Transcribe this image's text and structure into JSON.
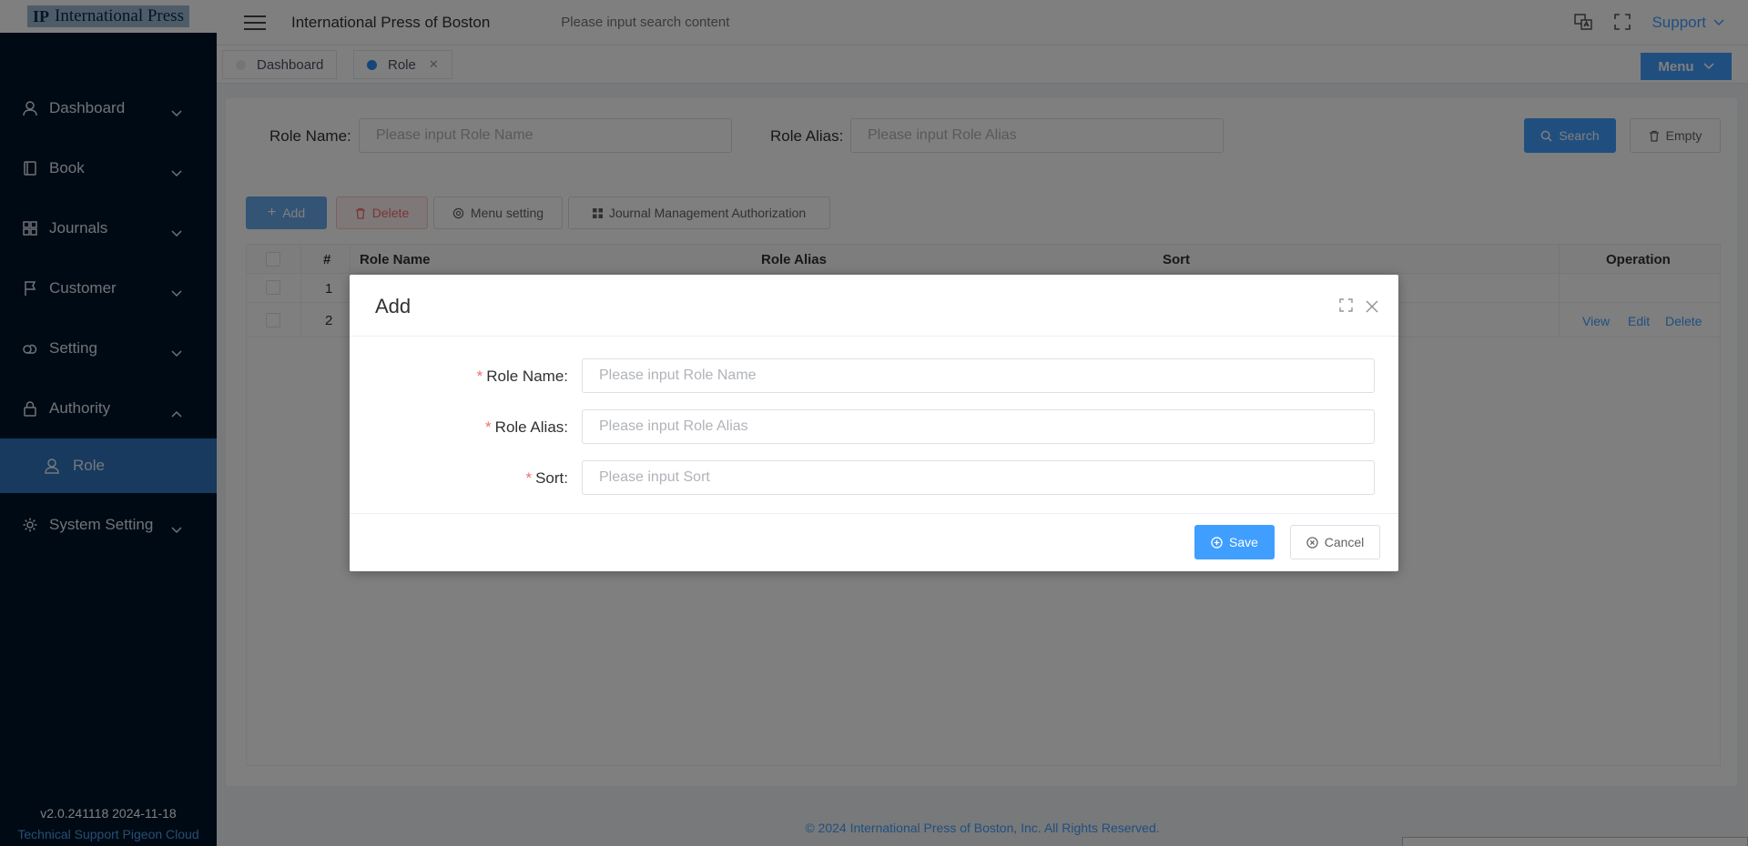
{
  "logo": {
    "mark": "IP",
    "text": "International Press"
  },
  "sidebar": {
    "items": [
      {
        "label": "Dashboard",
        "icon": "user-icon"
      },
      {
        "label": "Book",
        "icon": "book-icon"
      },
      {
        "label": "Journals",
        "icon": "grid-icon"
      },
      {
        "label": "Customer",
        "icon": "flag-icon"
      },
      {
        "label": "Setting",
        "icon": "cloud-icon"
      },
      {
        "label": "Authority",
        "icon": "lock-icon"
      }
    ],
    "sub_item": {
      "label": "Role",
      "icon": "person-icon"
    },
    "last_item": {
      "label": "System Setting",
      "icon": "gear-icon"
    },
    "version": "v2.0.241118 2024-11-18",
    "tech_support": "Technical Support Pigeon Cloud"
  },
  "topbar": {
    "title": "International Press of Boston",
    "search_placeholder": "Please input search content",
    "support_label": "Support"
  },
  "tabs": [
    {
      "label": "Dashboard"
    },
    {
      "label": "Role"
    }
  ],
  "menu_button": "Menu",
  "filters": {
    "role_name_label": "Role Name:",
    "role_name_placeholder": "Please input Role Name",
    "role_alias_label": "Role Alias:",
    "role_alias_placeholder": "Please input Role Alias",
    "search_label": "Search",
    "empty_label": "Empty"
  },
  "toolbar": {
    "add": "Add",
    "delete": "Delete",
    "menu_setting": "Menu setting",
    "journal_auth": "Journal Management Authorization"
  },
  "table": {
    "columns": [
      "#",
      "Role Name",
      "Role Alias",
      "Sort",
      "Operation"
    ],
    "rows": [
      {
        "index": "1"
      },
      {
        "index": "2",
        "ops": [
          "View",
          "Edit",
          "Delete"
        ]
      }
    ]
  },
  "footer": "© 2024 International Press of Boston, Inc. All Rights Reserved.",
  "dialog": {
    "title": "Add",
    "fields": [
      {
        "label": "Role Name:",
        "placeholder": "Please input Role Name"
      },
      {
        "label": "Role Alias:",
        "placeholder": "Please input Role Alias"
      },
      {
        "label": "Sort:",
        "placeholder": "Please input Sort"
      }
    ],
    "save": "Save",
    "cancel": "Cancel"
  },
  "colors": {
    "primary": "#409eff",
    "sidebar": "#001529",
    "active_menu": "#2f74bd",
    "danger": "#f56c6c"
  }
}
